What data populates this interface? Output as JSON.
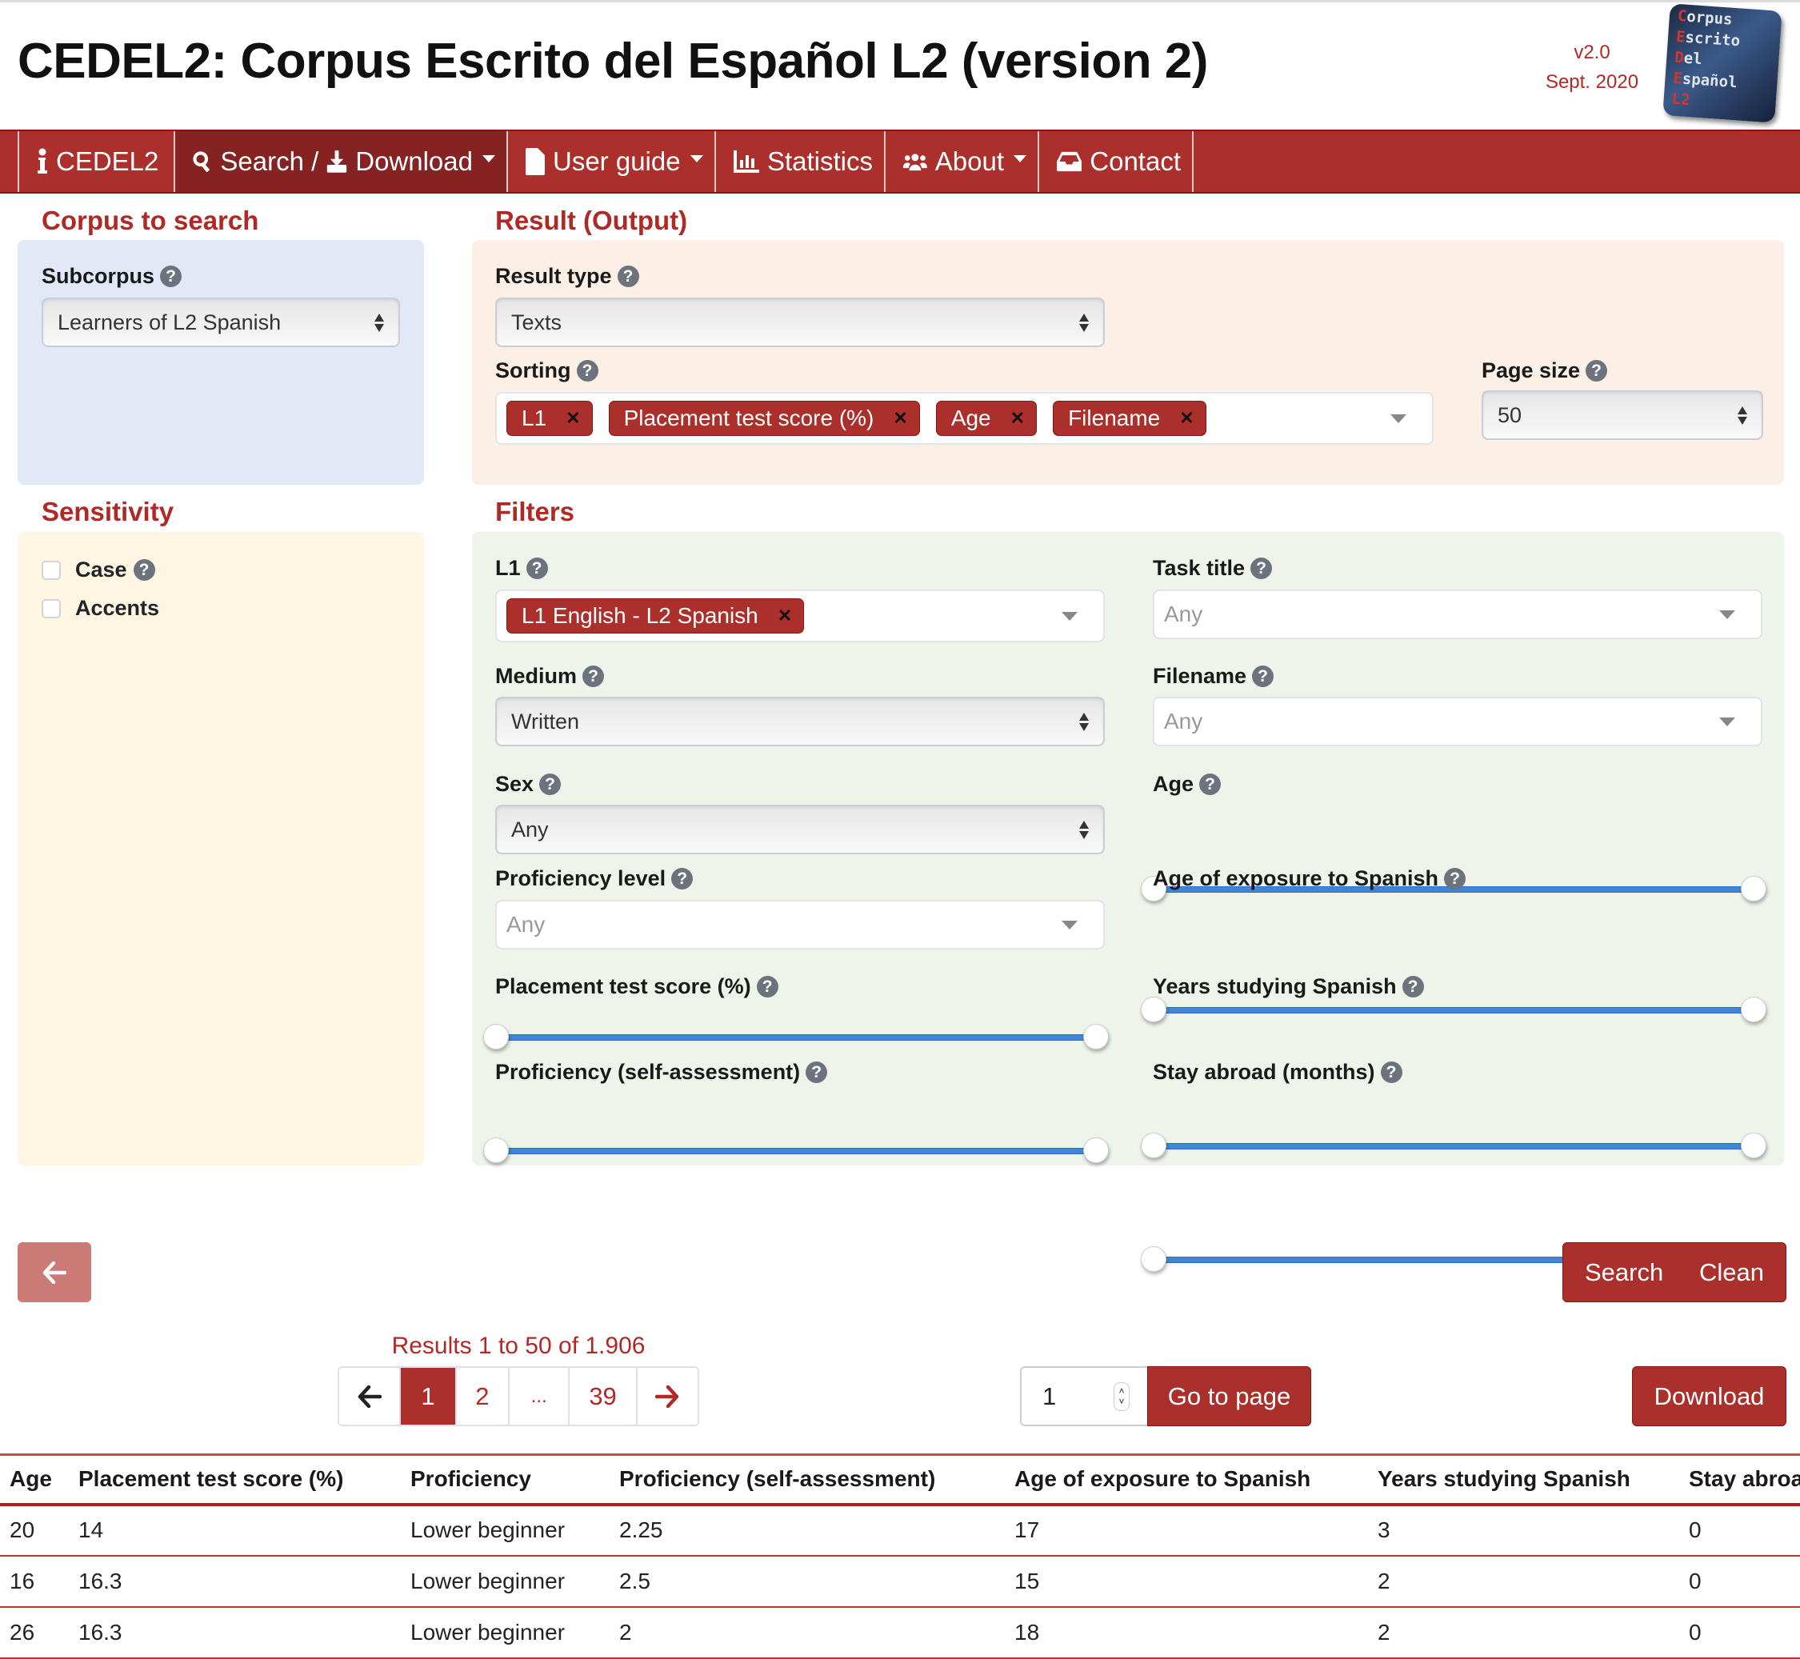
{
  "header": {
    "title": "CEDEL2: Corpus Escrito del Español L2 (version 2)",
    "version": "v2.0",
    "release_date": "Sept. 2020",
    "logo_lines": [
      {
        "cap": "C",
        "rest": "orpus"
      },
      {
        "cap": "E",
        "rest": "scrito"
      },
      {
        "cap": "D",
        "rest": "el"
      },
      {
        "cap": "E",
        "rest": "spañol"
      },
      {
        "cap": "L2",
        "rest": ""
      }
    ]
  },
  "nav": {
    "items": [
      {
        "icon": "info-icon",
        "label": "CEDEL2",
        "dropdown": false,
        "active": false
      },
      {
        "icon": "search-icon",
        "label": "Search /",
        "label2": "Download",
        "icon2": "download-icon",
        "dropdown": true,
        "active": true
      },
      {
        "icon": "file-icon",
        "label": "User guide",
        "dropdown": true,
        "active": false
      },
      {
        "icon": "bar-chart-icon",
        "label": "Statistics",
        "dropdown": false,
        "active": false
      },
      {
        "icon": "users-icon",
        "label": "About",
        "dropdown": true,
        "active": false
      },
      {
        "icon": "inbox-icon",
        "label": "Contact",
        "dropdown": false,
        "active": false
      }
    ]
  },
  "corpus": {
    "heading": "Corpus to search",
    "subcorpus_label": "Subcorpus",
    "subcorpus_value": "Learners of L2 Spanish"
  },
  "result": {
    "heading": "Result (Output)",
    "result_type_label": "Result type",
    "result_type_value": "Texts",
    "sorting_label": "Sorting",
    "sorting_chips": [
      "L1",
      "Placement test score (%)",
      "Age",
      "Filename"
    ],
    "page_size_label": "Page size",
    "page_size_value": "50"
  },
  "sensitivity": {
    "heading": "Sensitivity",
    "options": [
      {
        "label": "Case",
        "checked": false,
        "help": true
      },
      {
        "label": "Accents",
        "checked": false,
        "help": false
      }
    ]
  },
  "filters": {
    "heading": "Filters",
    "l1_label": "L1",
    "l1_chips": [
      "L1 English - L2 Spanish"
    ],
    "task_title_label": "Task title",
    "task_title_placeholder": "Any",
    "medium_label": "Medium",
    "medium_value": "Written",
    "filename_label": "Filename",
    "filename_placeholder": "Any",
    "sex_label": "Sex",
    "sex_value": "Any",
    "age_label": "Age",
    "age_range": [
      0,
      1
    ],
    "proficiency_level_label": "Proficiency level",
    "proficiency_level_placeholder": "Any",
    "age_exposure_label": "Age of exposure to Spanish",
    "age_exposure_range": [
      0,
      1
    ],
    "placement_label": "Placement test score (%)",
    "placement_range": [
      0,
      1
    ],
    "years_studying_label": "Years studying Spanish",
    "years_studying_range": [
      0,
      1
    ],
    "self_assessment_label": "Proficiency (self-assessment)",
    "self_assessment_range": [
      0,
      1
    ],
    "stay_abroad_label": "Stay abroad (months)",
    "stay_abroad_range": [
      0,
      1
    ]
  },
  "actions": {
    "back_icon": "arrow-left-icon",
    "search_label": "Search",
    "clean_label": "Clean"
  },
  "pagination": {
    "results_text": "Results 1 to 50 of 1.906",
    "prev_icon": "arrow-left-icon",
    "pages": [
      "1",
      "2",
      "...",
      "39"
    ],
    "current_page": "1",
    "next_icon": "arrow-right-icon",
    "goto_value": "1",
    "goto_label": "Go to page",
    "download_label": "Download"
  },
  "table": {
    "columns": [
      "Age",
      "Placement test score (%)",
      "Proficiency",
      "Proficiency (self-assessment)",
      "Age of exposure to Spanish",
      "Years studying Spanish",
      "Stay abroad"
    ],
    "rows": [
      [
        "20",
        "14",
        "Lower beginner",
        "2.25",
        "17",
        "3",
        "0"
      ],
      [
        "16",
        "16.3",
        "Lower beginner",
        "2.5",
        "15",
        "2",
        "0"
      ],
      [
        "26",
        "16.3",
        "Lower beginner",
        "2",
        "18",
        "2",
        "0"
      ]
    ]
  },
  "colors": {
    "brand_red": "#ab2f2b",
    "nav_active": "#842322",
    "heading_red": "#b02a25",
    "slider_blue": "#3f86d6"
  }
}
